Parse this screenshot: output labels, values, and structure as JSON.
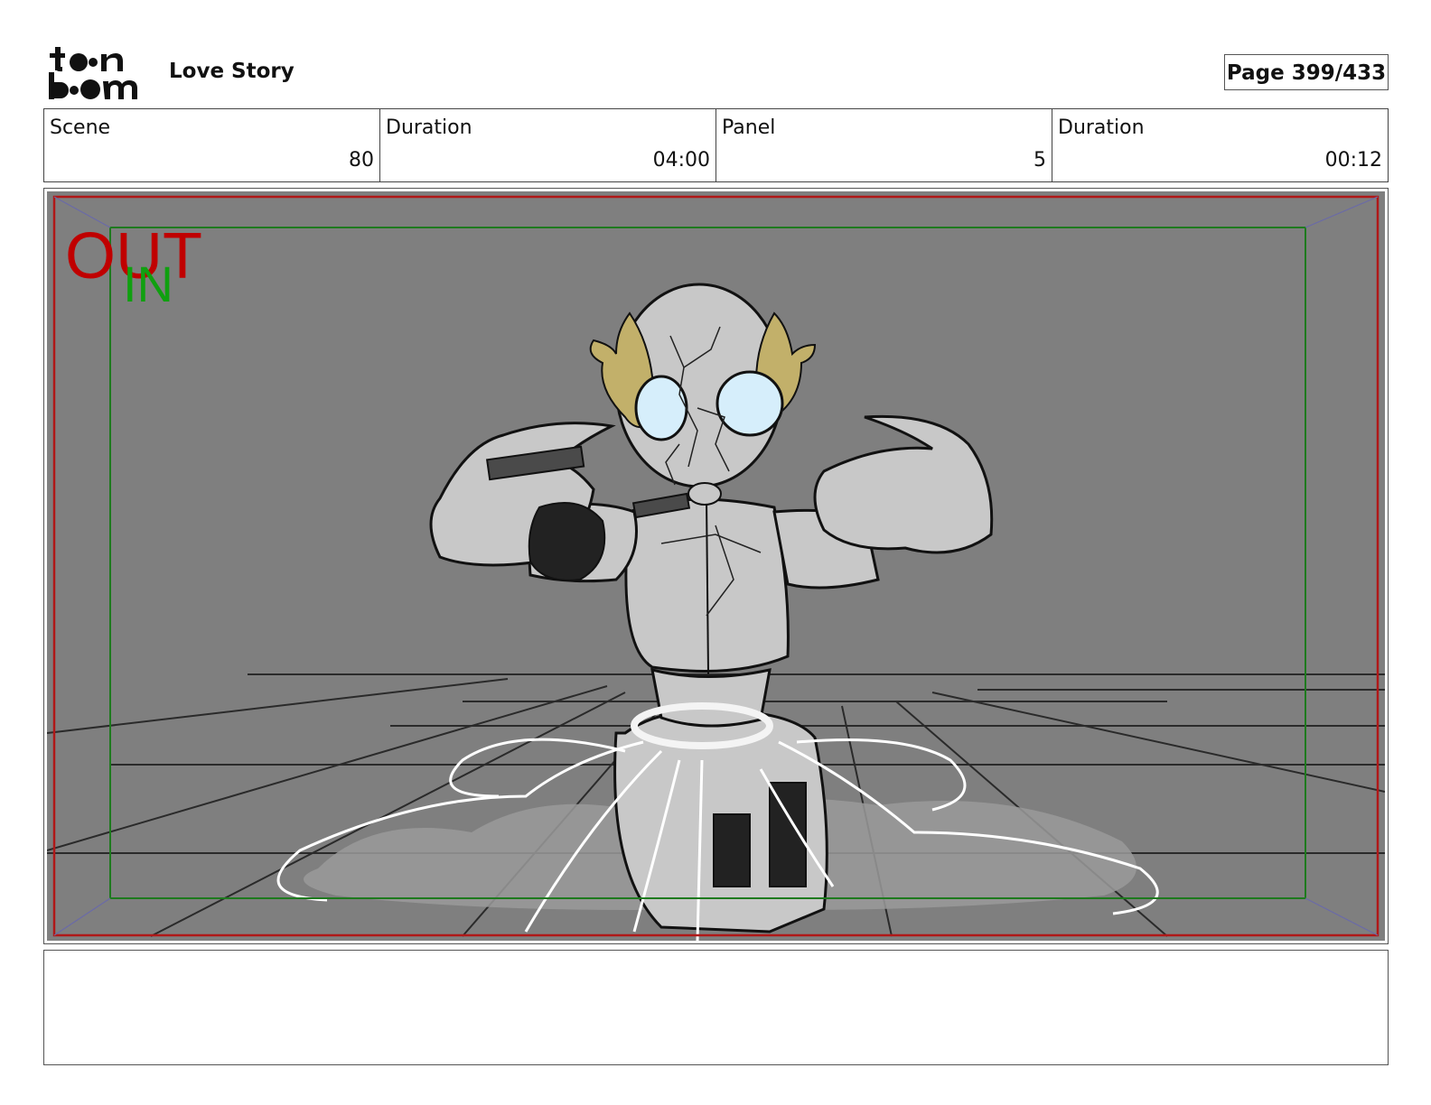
{
  "header": {
    "logo_text": "toon boom",
    "project_title": "Love Story",
    "page_label": "Page 399/433"
  },
  "info": [
    {
      "label": "Scene",
      "value": "80"
    },
    {
      "label": "Duration",
      "value": "04:00"
    },
    {
      "label": "Panel",
      "value": "5"
    },
    {
      "label": "Duration",
      "value": "00:12"
    }
  ],
  "panel": {
    "safe_frame_labels": {
      "out": "OUT",
      "in": "IN"
    },
    "colors": {
      "background": "#7f7f7f",
      "out_frame": "#b01818",
      "in_frame": "#1e7a1e",
      "out_label": "#c00000",
      "in_label": "#10a010",
      "character_fill": "#c8c8c8",
      "hair": "#c2b06a",
      "eye": "#d6eefb"
    }
  },
  "notes": {
    "text": ""
  }
}
